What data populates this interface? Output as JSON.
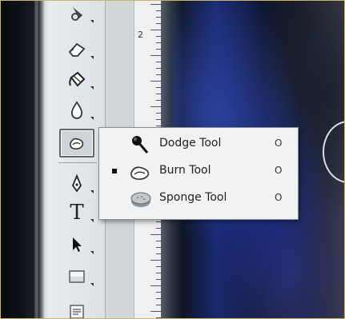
{
  "ruler": {
    "label": "2"
  },
  "toolbar": {
    "tools": [
      {
        "name": "history-brush"
      },
      {
        "name": "eraser"
      },
      {
        "name": "paint-bucket"
      },
      {
        "name": "blur"
      },
      {
        "name": "burn",
        "selected": true
      },
      {
        "name": "pen"
      },
      {
        "name": "type",
        "glyph": "T"
      },
      {
        "name": "path-selection"
      },
      {
        "name": "rectangle"
      },
      {
        "name": "notes"
      }
    ]
  },
  "flyout": {
    "items": [
      {
        "label": "Dodge Tool",
        "shortcut": "O",
        "icon": "dodge-icon",
        "active": false
      },
      {
        "label": "Burn Tool",
        "shortcut": "O",
        "icon": "burn-icon",
        "active": true
      },
      {
        "label": "Sponge Tool",
        "shortcut": "O",
        "icon": "sponge-icon",
        "active": false
      }
    ]
  },
  "colors": {
    "flyout_bg": "#f0f2f4",
    "toolbar_bg": "#e9ecef",
    "canvas_blue": "#1c2f8a"
  }
}
